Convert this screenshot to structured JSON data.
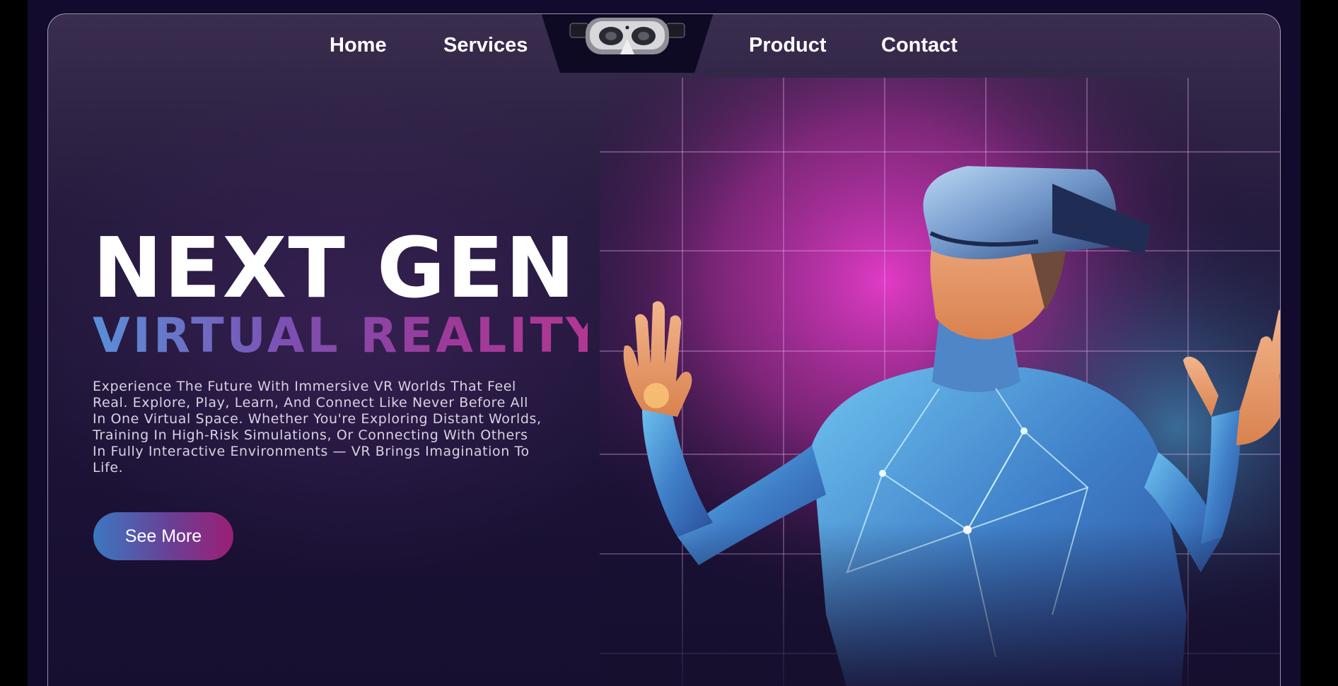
{
  "nav": {
    "links": [
      {
        "label": "Home"
      },
      {
        "label": "Services"
      },
      {
        "label": "Product"
      },
      {
        "label": "Contact"
      }
    ],
    "logo_icon": "vr-headset-icon"
  },
  "hero": {
    "title_line1": "NEXT GEN",
    "title_line2": "VIRTUAL REALITY",
    "description": "Experience The Future With Immersive VR Worlds That Feel Real. Explore, Play, Learn, And Connect Like Never Before All In One Virtual Space. Whether You're Exploring Distant Worlds, Training In High-Risk Simulations, Or Connecting With Others In Fully Interactive Environments — VR Brings Imagination To Life.",
    "cta_label": "See More",
    "image": "person-wearing-vr-headset-illustration"
  },
  "colors": {
    "background": "#120b2e",
    "card_top": "#3a2d4e",
    "accent_blue": "#3b78c0",
    "accent_magenta": "#b23793",
    "text_white": "#ffffff"
  }
}
